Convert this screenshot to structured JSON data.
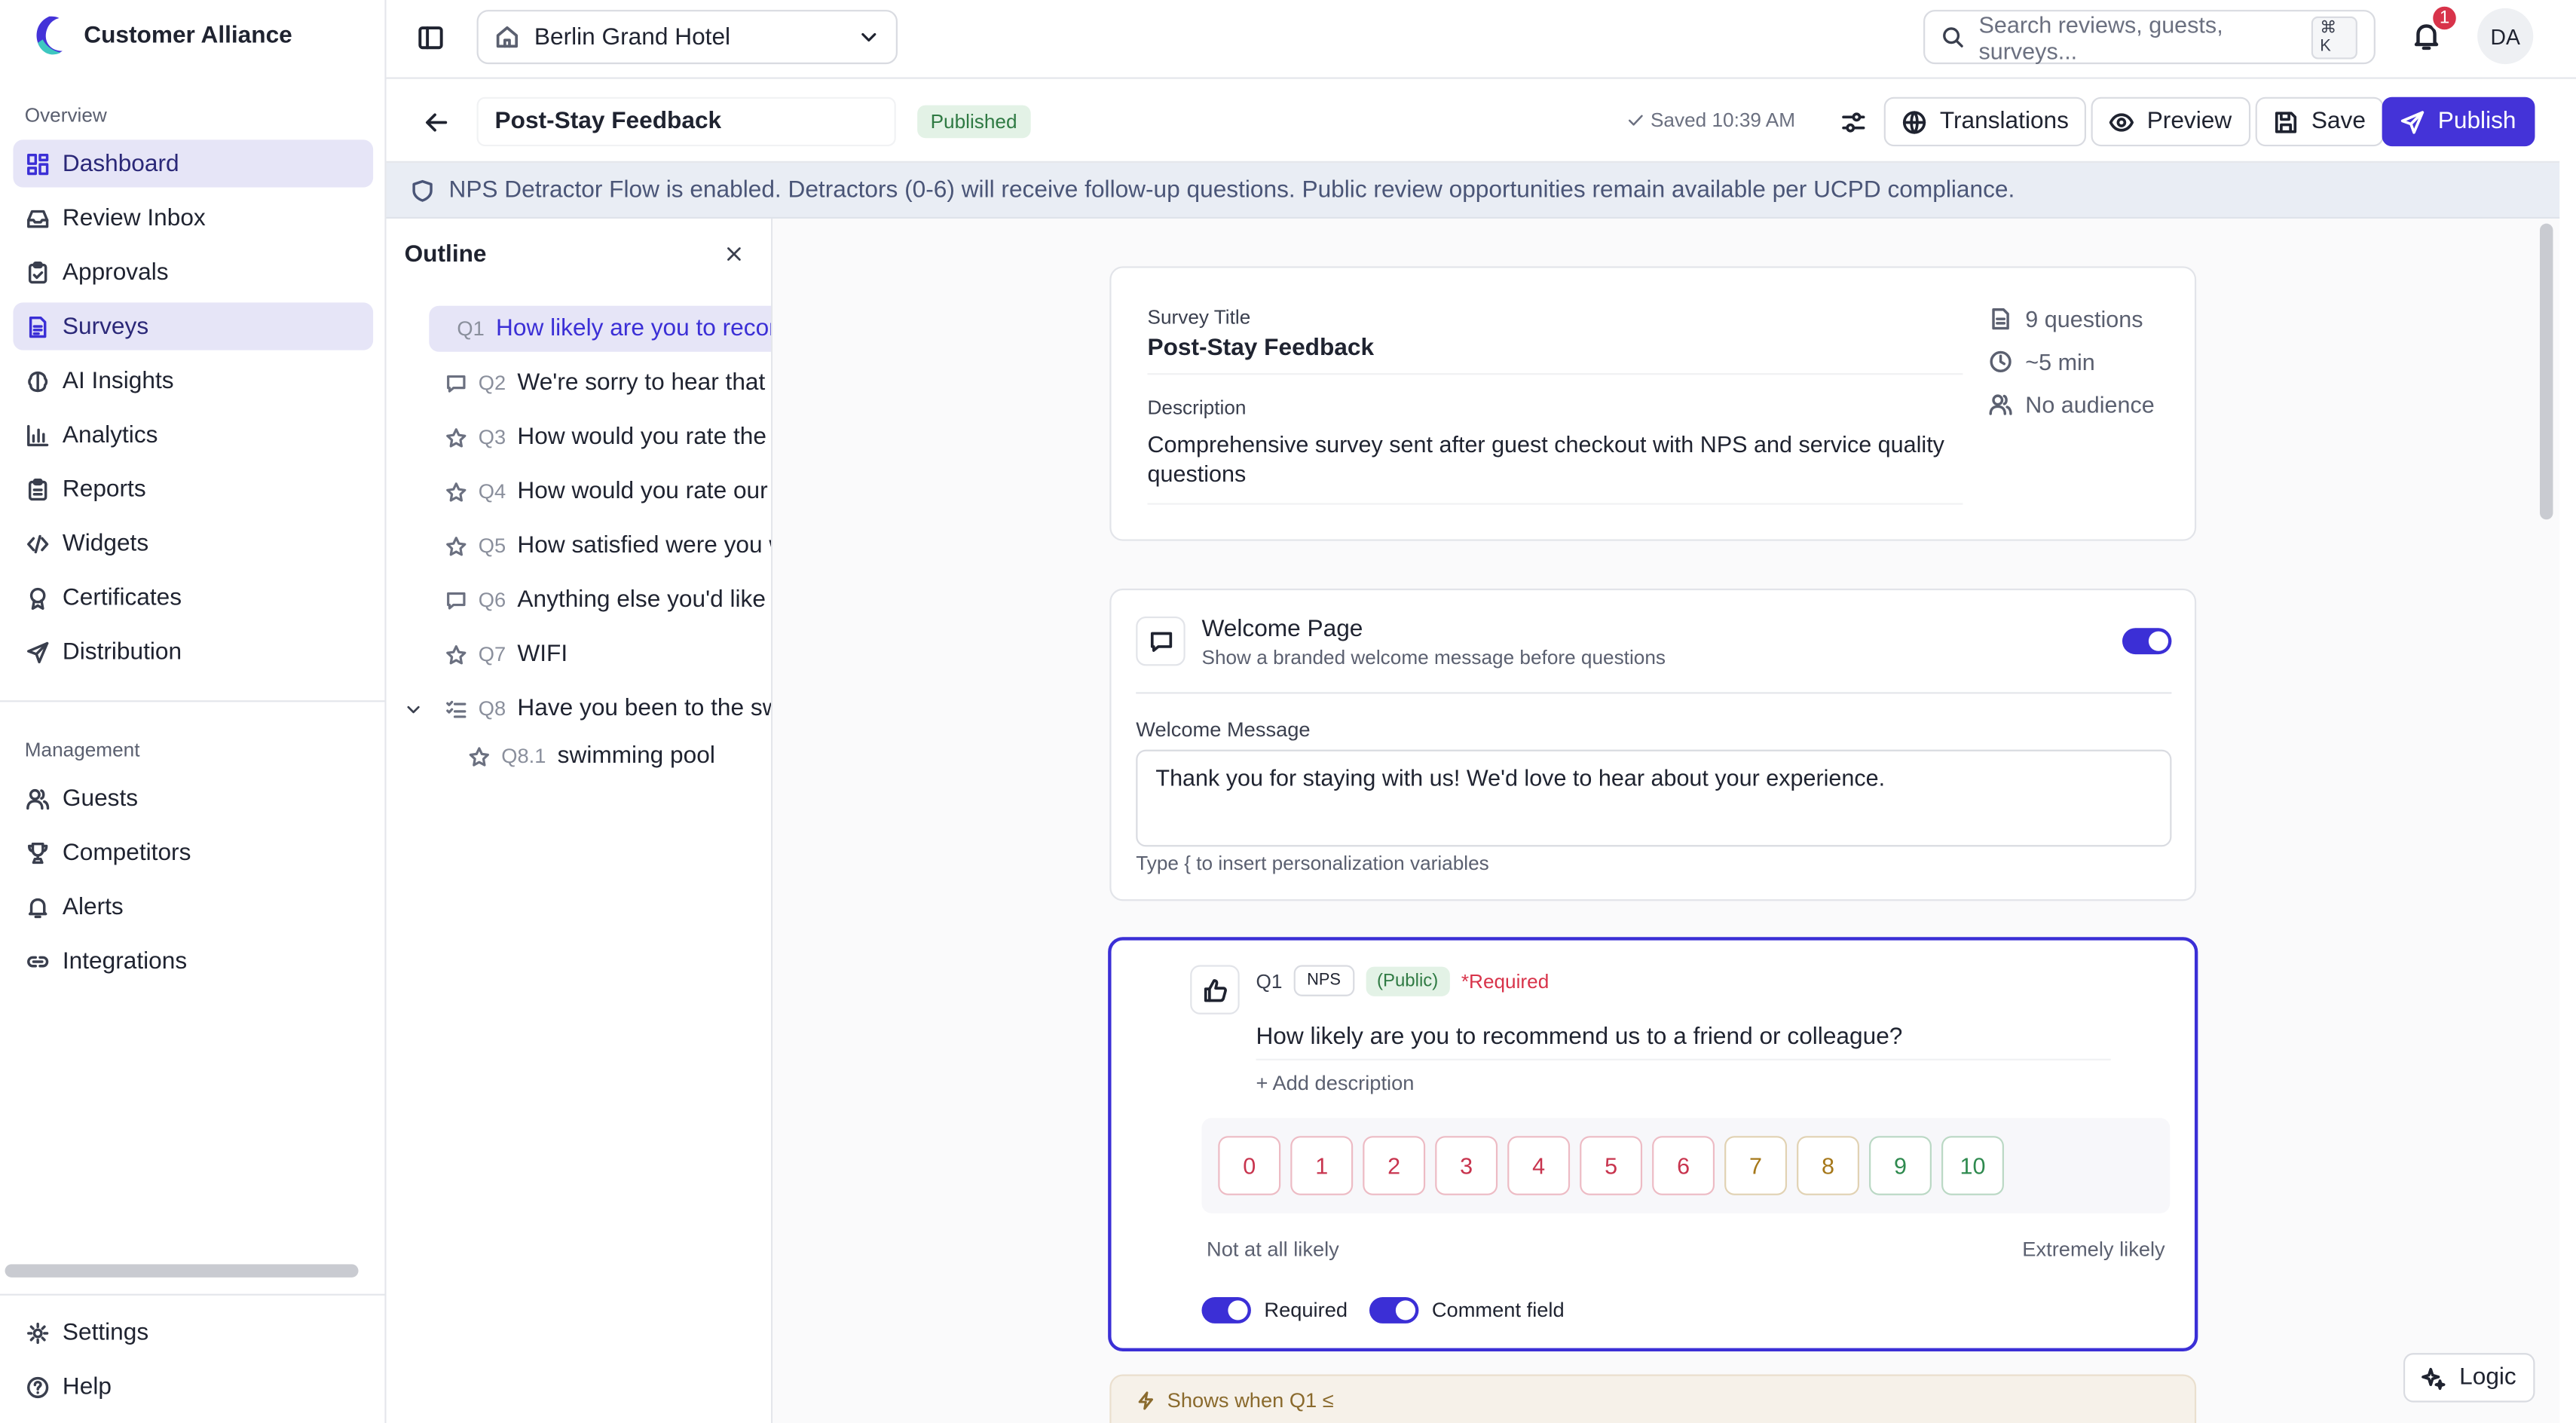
{
  "brand": {
    "name": "Customer Alliance"
  },
  "sidebar": {
    "overview_title": "Overview",
    "overview_items": [
      {
        "label": "Dashboard",
        "icon": "dashboard-icon"
      },
      {
        "label": "Review Inbox",
        "icon": "inbox-icon"
      },
      {
        "label": "Approvals",
        "icon": "clipboard-check-icon"
      },
      {
        "label": "Surveys",
        "icon": "file-text-icon"
      },
      {
        "label": "AI Insights",
        "icon": "brain-icon"
      },
      {
        "label": "Analytics",
        "icon": "bar-chart-icon"
      },
      {
        "label": "Reports",
        "icon": "clipboard-icon"
      },
      {
        "label": "Widgets",
        "icon": "code-icon"
      },
      {
        "label": "Certificates",
        "icon": "award-icon"
      },
      {
        "label": "Distribution",
        "icon": "send-icon"
      }
    ],
    "management_title": "Management",
    "management_items": [
      {
        "label": "Guests",
        "icon": "users-icon"
      },
      {
        "label": "Competitors",
        "icon": "trophy-icon"
      },
      {
        "label": "Alerts",
        "icon": "bell-icon"
      },
      {
        "label": "Integrations",
        "icon": "link-icon"
      }
    ],
    "footer_items": [
      {
        "label": "Settings",
        "icon": "gear-icon"
      },
      {
        "label": "Help",
        "icon": "help-icon"
      }
    ]
  },
  "topbar": {
    "hotel": "Berlin Grand Hotel",
    "search_placeholder": "Search reviews, guests, surveys...",
    "search_shortcut": "⌘ K",
    "notification_count": "1",
    "avatar_initials": "DA"
  },
  "editor": {
    "title": "Post-Stay Feedback",
    "status": "Published",
    "saved": "Saved 10:39 AM",
    "buttons": {
      "translations": "Translations",
      "preview": "Preview",
      "save": "Save",
      "publish": "Publish"
    }
  },
  "banner": {
    "text": "NPS Detractor Flow is enabled. Detractors (0-6) will receive follow-up questions. Public review opportunities remain available per UCPD compliance."
  },
  "outline": {
    "title": "Outline",
    "items": [
      {
        "num": "Q1",
        "text": "How likely are you to recommend us to a friend or colleague?",
        "icon": "thumbs-up-icon"
      },
      {
        "num": "Q2",
        "text": "We're sorry to hear that - what could we improve?",
        "icon": "comment-icon"
      },
      {
        "num": "Q3",
        "text": "How would you rate the cleanliness of your room?",
        "icon": "star-icon"
      },
      {
        "num": "Q4",
        "text": "How would you rate our staff?",
        "icon": "star-icon"
      },
      {
        "num": "Q5",
        "text": "How satisfied were you with breakfast?",
        "icon": "star-icon"
      },
      {
        "num": "Q6",
        "text": "Anything else you'd like to share?",
        "icon": "comment-icon"
      },
      {
        "num": "Q7",
        "text": "WIFI",
        "icon": "star-icon"
      },
      {
        "num": "Q8",
        "text": "Have you been to the swimming pool?",
        "icon": "list-check-icon"
      },
      {
        "num": "Q8.1",
        "text": "swimming pool",
        "icon": "star-icon"
      }
    ]
  },
  "survey": {
    "title_label": "Survey Title",
    "title": "Post-Stay Feedback",
    "description_label": "Description",
    "description": "Comprehensive survey sent after guest checkout with NPS and service quality questions",
    "meta": {
      "questions": "9 questions",
      "duration": "~5 min",
      "audience": "No audience"
    }
  },
  "welcome": {
    "title": "Welcome Page",
    "subtitle": "Show a branded welcome message before questions",
    "enabled": true,
    "message_label": "Welcome Message",
    "message": "Thank you for staying with us! We'd love to hear about your experience.",
    "hint": "Type { to insert personalization variables"
  },
  "question": {
    "num": "Q1",
    "type_chip": "NPS",
    "visibility_chip": "(Public)",
    "required_label": "*Required",
    "text": "How likely are you to recommend us to a friend or colleague?",
    "add_description": "+ Add description",
    "scale": [
      "0",
      "1",
      "2",
      "3",
      "4",
      "5",
      "6",
      "7",
      "8",
      "9",
      "10"
    ],
    "scale_colors": [
      "#c8344e",
      "#c8344e",
      "#c8344e",
      "#c8344e",
      "#c8344e",
      "#c8344e",
      "#c8344e",
      "#a6781a",
      "#a6781a",
      "#2f8a4f",
      "#2f8a4f"
    ],
    "low_label": "Not at all likely",
    "high_label": "Extremely likely",
    "required_toggle": "Required",
    "comment_toggle": "Comment field"
  },
  "condition": {
    "text": "Shows when Q1 ≤"
  },
  "logic_button": "Logic",
  "colors": {
    "accent": "#3b2fd6",
    "primary_button": "#4433d8",
    "banner_bg": "#e9edf4",
    "selected_bg": "#e6e5f7"
  }
}
